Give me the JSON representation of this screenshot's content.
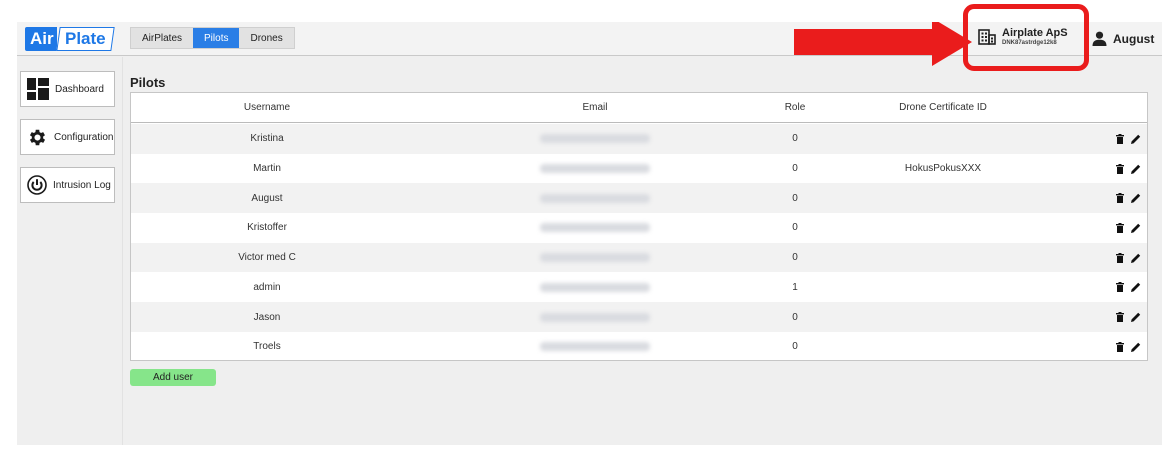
{
  "logo": {
    "part1": "Air",
    "part2": "Plate"
  },
  "nav_tabs": [
    {
      "label": "AirPlates",
      "active": false
    },
    {
      "label": "Pilots",
      "active": true
    },
    {
      "label": "Drones",
      "active": false
    }
  ],
  "company": {
    "name": "Airplate ApS",
    "code": "DNK87astrdge12k8",
    "icon": "building-icon"
  },
  "user": {
    "name": "August",
    "icon": "user-icon"
  },
  "sidebar": {
    "items": [
      {
        "label": "Dashboard",
        "icon": "dashboard-icon"
      },
      {
        "label": "Configuration",
        "icon": "gear-icon"
      },
      {
        "label": "Intrusion Log",
        "icon": "power-icon"
      }
    ]
  },
  "page": {
    "title": "Pilots"
  },
  "table": {
    "columns": [
      "Username",
      "Email",
      "Role",
      "Drone Certificate ID"
    ],
    "rows": [
      {
        "username": "Kristina",
        "role": "0",
        "cert": ""
      },
      {
        "username": "Martin",
        "role": "0",
        "cert": "HokusPokusXXX"
      },
      {
        "username": "August",
        "role": "0",
        "cert": ""
      },
      {
        "username": "Kristoffer",
        "role": "0",
        "cert": ""
      },
      {
        "username": "Victor med C",
        "role": "0",
        "cert": ""
      },
      {
        "username": "admin",
        "role": "1",
        "cert": ""
      },
      {
        "username": "Jason",
        "role": "0",
        "cert": ""
      },
      {
        "username": "Troels",
        "role": "0",
        "cert": ""
      }
    ]
  },
  "actions": {
    "add_user_label": "Add user"
  },
  "colors": {
    "accent": "#2a7ee6",
    "highlight": "#ea1c1c",
    "add_button": "#86e58a"
  }
}
